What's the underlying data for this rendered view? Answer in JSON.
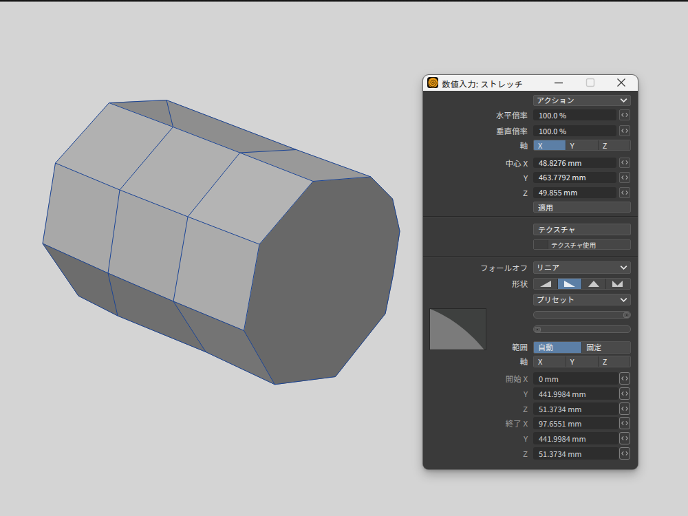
{
  "window": {
    "title": "数値入力: ストレッチ",
    "titlebar_icons": [
      "minimize-icon",
      "maximize-icon",
      "close-icon"
    ]
  },
  "dialog": {
    "action_dropdown": {
      "label": "アクション"
    },
    "rows": {
      "h_scale": {
        "label": "水平倍率",
        "value": "100.0 %"
      },
      "v_scale": {
        "label": "垂直倍率",
        "value": "100.0 %"
      },
      "axis": {
        "label": "軸",
        "options": [
          "X",
          "Y",
          "Z"
        ],
        "selected": "X"
      },
      "center_x": {
        "label": "中心 X",
        "value": "48.8276 mm"
      },
      "center_y": {
        "label": "Y",
        "value": "463.7792 mm"
      },
      "center_z": {
        "label": "Z",
        "value": "49.855 mm"
      },
      "apply_button": {
        "label": "適用"
      },
      "texture_button": {
        "label": "テクスチャ"
      },
      "texture_use_button": {
        "label": "テクスチャ使用"
      },
      "falloff": {
        "label": "フォールオフ",
        "value": "リニア"
      },
      "shape": {
        "label": "形状",
        "selected_index": 1,
        "icons": [
          "ramp-up-triangle-icon",
          "ramp-down-triangle-icon",
          "peak-triangle-icon",
          "valley-triangle-icon"
        ]
      },
      "preset_dropdown": {
        "label": "プリセット"
      },
      "range": {
        "label": "範囲",
        "options": [
          "自動",
          "固定"
        ],
        "selected": "自動"
      },
      "axis2": {
        "label": "軸",
        "options": [
          "X",
          "Y",
          "Z"
        ],
        "selected": ""
      },
      "start_x": {
        "label": "開始 X",
        "group": "開始",
        "axis": "X",
        "value": "0 mm"
      },
      "start_y": {
        "label": "Y",
        "value": "441.9984 mm"
      },
      "start_z": {
        "label": "Z",
        "value": "51.3734 mm"
      },
      "end_x": {
        "label": "終了 X",
        "group": "終了",
        "axis": "X",
        "value": "97.6551 mm"
      },
      "end_y": {
        "label": "Y",
        "value": "441.9984 mm"
      },
      "end_z": {
        "label": "Z",
        "value": "51.3734 mm"
      }
    },
    "colors": {
      "body": "#3a3a3a",
      "titlebar": "#f2f2f2",
      "field_bg": "#2d2d2d",
      "button_bg": "#4a4a4a",
      "accent_blue": "#5c7fa6",
      "text_light": "#e6e6e6",
      "label_text": "#d8d8d8",
      "dim_text": "#b4b4b4"
    }
  },
  "viewport": {
    "bg": "#d4d4d4",
    "edge_color": "#1a4496",
    "scene_polys": [
      {
        "name": "end-cap-face",
        "fill": "#686868",
        "pts": [
          [
            539,
            257
          ],
          [
            570.5,
            289
          ],
          [
            581,
            336
          ],
          [
            571.5,
            399
          ],
          [
            560,
            456
          ],
          [
            487.5,
            547.5
          ],
          [
            399.4,
            558.8
          ],
          [
            354.5,
            480.5
          ],
          [
            377,
            355
          ],
          [
            455,
            263.5
          ]
        ]
      },
      {
        "name": "top-back-strip-seg3",
        "fill": "#999999",
        "pts": [
          [
            430.5,
            217.5
          ],
          [
            539,
            257
          ],
          [
            455,
            263.5
          ],
          [
            348.7,
            222
          ]
        ]
      },
      {
        "name": "top-back-strip-seg2",
        "fill": "#8e8e8e",
        "pts": [
          [
            242,
            145.5
          ],
          [
            430.5,
            217.5
          ],
          [
            348.7,
            222
          ],
          [
            251.5,
            184.5
          ]
        ]
      },
      {
        "name": "top-back-strip-seg1",
        "fill": "#898989",
        "pts": [
          [
            158.5,
            149.5
          ],
          [
            242,
            145.5
          ],
          [
            251.5,
            184.5
          ]
        ]
      },
      {
        "name": "top-strip-seg1",
        "fill": "#b1b1b1",
        "pts": [
          [
            158.5,
            149.5
          ],
          [
            251.5,
            184.5
          ],
          [
            174,
            276
          ],
          [
            80.5,
            237
          ]
        ]
      },
      {
        "name": "top-strip-seg2",
        "fill": "#b0b0b0",
        "pts": [
          [
            251.5,
            184.5
          ],
          [
            348.7,
            222
          ],
          [
            273,
            315
          ],
          [
            174,
            276
          ]
        ]
      },
      {
        "name": "top-strip-seg3",
        "fill": "#b4b4b4",
        "pts": [
          [
            348.7,
            222
          ],
          [
            455,
            263.5
          ],
          [
            377,
            355
          ],
          [
            273,
            315
          ]
        ]
      },
      {
        "name": "front-strip-seg1",
        "fill": "#a8a8a8",
        "pts": [
          [
            80.5,
            237
          ],
          [
            174,
            276
          ],
          [
            157,
            397
          ],
          [
            62,
            354
          ]
        ]
      },
      {
        "name": "front-strip-seg2",
        "fill": "#a7a7a7",
        "pts": [
          [
            174,
            276
          ],
          [
            273,
            315
          ],
          [
            252,
            438
          ],
          [
            157,
            397
          ]
        ]
      },
      {
        "name": "front-strip-seg3",
        "fill": "#ababab",
        "pts": [
          [
            273,
            315
          ],
          [
            377,
            355
          ],
          [
            354.5,
            480.5
          ],
          [
            252,
            438
          ]
        ]
      },
      {
        "name": "bottom-strip-seg1",
        "fill": "#6d6d6d",
        "pts": [
          [
            62,
            354
          ],
          [
            157,
            397
          ],
          [
            171,
            459
          ],
          [
            114,
            430
          ]
        ]
      },
      {
        "name": "bottom-strip-seg2",
        "fill": "#6f6f6f",
        "pts": [
          [
            157,
            397
          ],
          [
            252,
            438
          ],
          [
            299.2,
            511.6
          ],
          [
            171,
            459
          ]
        ]
      },
      {
        "name": "bottom-strip-seg3",
        "fill": "#747474",
        "pts": [
          [
            252,
            438
          ],
          [
            354.5,
            480.5
          ],
          [
            399.4,
            558.8
          ],
          [
            299.2,
            511.6
          ]
        ]
      }
    ],
    "scene_edges": [
      {
        "name": "ring0-silhouette-edges",
        "pts": [
          [
            158.5,
            149.5
          ],
          [
            80.5,
            237
          ],
          [
            62,
            354
          ],
          [
            114,
            430
          ]
        ]
      },
      {
        "name": "ring1-edges",
        "pts": [
          [
            242,
            145.5
          ],
          [
            251.5,
            184.5
          ],
          [
            174,
            276
          ],
          [
            157,
            397
          ],
          [
            171,
            459
          ]
        ]
      },
      {
        "name": "ring2-edges",
        "pts": [
          [
            430.5,
            217.5
          ],
          [
            348.7,
            222
          ],
          [
            273,
            315
          ],
          [
            252,
            438
          ],
          [
            299.2,
            511.6
          ]
        ]
      },
      {
        "name": "end-cap-outline",
        "pts": [
          [
            539,
            257
          ],
          [
            570.5,
            289
          ],
          [
            581,
            336
          ],
          [
            571.5,
            399
          ],
          [
            560,
            456
          ],
          [
            487.5,
            547.5
          ],
          [
            399.4,
            558.8
          ],
          [
            354.5,
            480.5
          ],
          [
            377,
            355
          ],
          [
            455,
            263.5
          ],
          [
            539,
            257
          ]
        ]
      },
      {
        "name": "lengthwise-top-back-edge",
        "pts": [
          [
            158.5,
            149.5
          ],
          [
            242,
            145.5
          ],
          [
            430.5,
            217.5
          ],
          [
            539,
            257
          ]
        ]
      },
      {
        "name": "lengthwise-ridge-edge",
        "pts": [
          [
            158.5,
            149.5
          ],
          [
            251.5,
            184.5
          ],
          [
            348.7,
            222
          ],
          [
            455,
            263.5
          ]
        ]
      },
      {
        "name": "lengthwise-upper-front-edge",
        "pts": [
          [
            80.5,
            237
          ],
          [
            174,
            276
          ],
          [
            273,
            315
          ],
          [
            377,
            355
          ]
        ]
      },
      {
        "name": "lengthwise-lower-front-edge",
        "pts": [
          [
            62,
            354
          ],
          [
            157,
            397
          ],
          [
            252,
            438
          ],
          [
            354.5,
            480.5
          ]
        ]
      },
      {
        "name": "lengthwise-bottom-edge",
        "pts": [
          [
            114,
            430
          ],
          [
            171,
            459
          ],
          [
            299.2,
            511.6
          ],
          [
            399.4,
            558.8
          ]
        ]
      }
    ]
  }
}
